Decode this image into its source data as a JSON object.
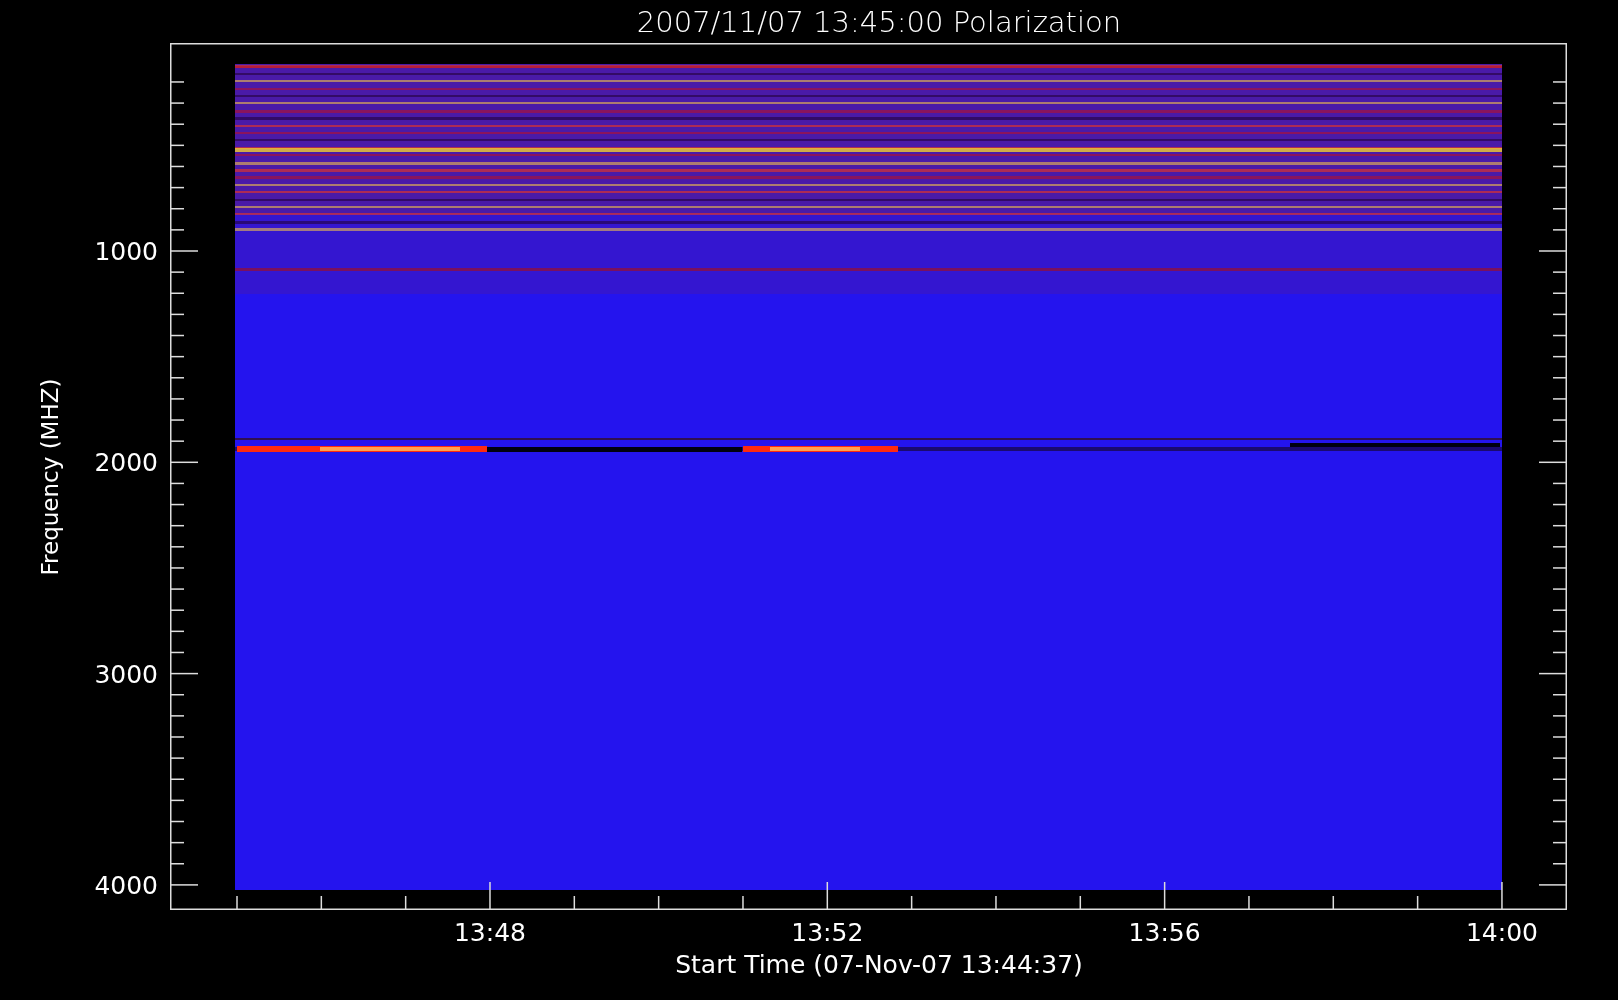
{
  "title": "2007/11/07 13:45:00 Polarization",
  "y_axis": {
    "label": "Frequency (MHZ)",
    "ticks": [
      "1000",
      "2000",
      "3000",
      "4000"
    ]
  },
  "x_axis": {
    "label": "Start Time (07-Nov-07 13:44:37)",
    "ticks": [
      "13:48",
      "13:52",
      "13:56",
      "14:00"
    ]
  }
}
